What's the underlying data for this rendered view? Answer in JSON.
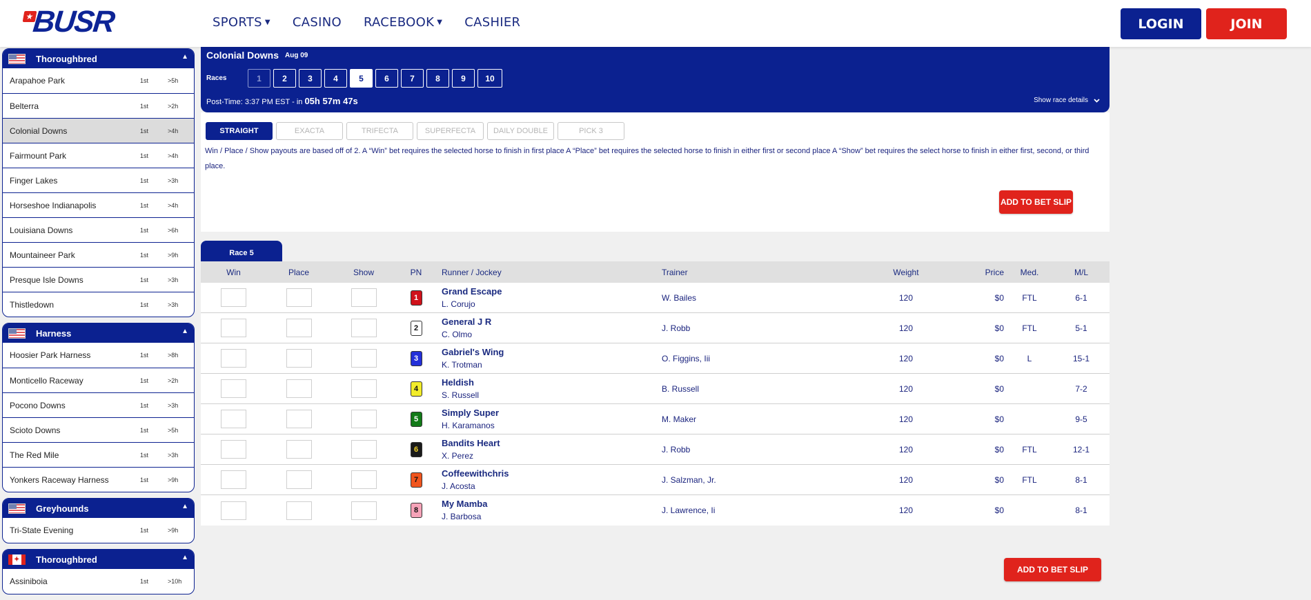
{
  "header": {
    "logo_text": "BUSR",
    "nav": [
      {
        "label": "SPORTS",
        "has_dropdown": true
      },
      {
        "label": "CASINO",
        "has_dropdown": false
      },
      {
        "label": "RACEBOOK",
        "has_dropdown": true
      },
      {
        "label": "CASHIER",
        "has_dropdown": false
      }
    ],
    "login_label": "LOGIN",
    "join_label": "JOIN"
  },
  "sidebar": {
    "groups": [
      {
        "country": "US",
        "title": "Thoroughbred",
        "tracks": [
          {
            "name": "Arapahoe Park",
            "race": "1st",
            "time": ">5h"
          },
          {
            "name": "Belterra",
            "race": "1st",
            "time": ">2h"
          },
          {
            "name": "Colonial Downs",
            "race": "1st",
            "time": ">4h",
            "selected": true
          },
          {
            "name": "Fairmount Park",
            "race": "1st",
            "time": ">4h"
          },
          {
            "name": "Finger Lakes",
            "race": "1st",
            "time": ">3h"
          },
          {
            "name": "Horseshoe Indianapolis",
            "race": "1st",
            "time": ">4h"
          },
          {
            "name": "Louisiana Downs",
            "race": "1st",
            "time": ">6h"
          },
          {
            "name": "Mountaineer Park",
            "race": "1st",
            "time": ">9h"
          },
          {
            "name": "Presque Isle Downs",
            "race": "1st",
            "time": ">3h"
          },
          {
            "name": "Thistledown",
            "race": "1st",
            "time": ">3h"
          }
        ]
      },
      {
        "country": "US",
        "title": "Harness",
        "tracks": [
          {
            "name": "Hoosier Park Harness",
            "race": "1st",
            "time": ">8h"
          },
          {
            "name": "Monticello Raceway",
            "race": "1st",
            "time": ">2h"
          },
          {
            "name": "Pocono Downs",
            "race": "1st",
            "time": ">3h"
          },
          {
            "name": "Scioto Downs",
            "race": "1st",
            "time": ">5h"
          },
          {
            "name": "The Red Mile",
            "race": "1st",
            "time": ">3h"
          },
          {
            "name": "Yonkers Raceway Harness",
            "race": "1st",
            "time": ">9h"
          }
        ]
      },
      {
        "country": "US",
        "title": "Greyhounds",
        "tracks": [
          {
            "name": "Tri-State Evening",
            "race": "1st",
            "time": ">9h"
          }
        ]
      },
      {
        "country": "CA",
        "title": "Thoroughbred",
        "tracks": [
          {
            "name": "Assiniboia",
            "race": "1st",
            "time": ">10h"
          }
        ]
      }
    ]
  },
  "race_header": {
    "track": "Colonial Downs",
    "date": "Aug 09",
    "races_label": "Races",
    "races": [
      "1",
      "2",
      "3",
      "4",
      "5",
      "6",
      "7",
      "8",
      "9",
      "10"
    ],
    "active_race": "5",
    "disabled_races": [
      "1"
    ],
    "post_time_prefix": "Post-Time: 3:37 PM EST - in",
    "countdown": "05h 57m 47s",
    "details_label": "Show race details"
  },
  "bet_types": {
    "tabs": [
      "STRAIGHT",
      "EXACTA",
      "TRIFECTA",
      "SUPERFECTA",
      "DAILY DOUBLE",
      "PICK 3"
    ],
    "active": "STRAIGHT",
    "description": "Win / Place / Show payouts are based off of 2. A “Win” bet requires the selected horse to finish in first place A “Place” bet requires the selected horse to finish in either first or second place A “Show” bet requires the select horse to finish in either first, second, or third place.",
    "add_label": "ADD TO BET SLIP"
  },
  "race_table": {
    "tab_label": "Race 5",
    "columns": {
      "win": "Win",
      "place": "Place",
      "show": "Show",
      "pn": "PN",
      "runner": "Runner / Jockey",
      "trainer": "Trainer",
      "weight": "Weight",
      "price": "Price",
      "med": "Med.",
      "ml": "M/L"
    },
    "runners": [
      {
        "pn": "1",
        "pn_bg": "#d0121b",
        "pn_fg": "#ffffff",
        "name": "Grand Escape",
        "jockey": "L. Corujo",
        "trainer": "W. Bailes",
        "weight": "120",
        "price": "$0",
        "med": "FTL",
        "ml": "6-1"
      },
      {
        "pn": "2",
        "pn_bg": "#ffffff",
        "pn_fg": "#111111",
        "name": "General J R",
        "jockey": "C. Olmo",
        "trainer": "J. Robb",
        "weight": "120",
        "price": "$0",
        "med": "FTL",
        "ml": "5-1"
      },
      {
        "pn": "3",
        "pn_bg": "#2430d8",
        "pn_fg": "#ffffff",
        "name": "Gabriel's Wing",
        "jockey": "K. Trotman",
        "trainer": "O. Figgins, Iii",
        "weight": "120",
        "price": "$0",
        "med": "L",
        "ml": "15-1"
      },
      {
        "pn": "4",
        "pn_bg": "#f2ec2a",
        "pn_fg": "#111111",
        "name": "Heldish",
        "jockey": "S. Russell",
        "trainer": "B. Russell",
        "weight": "120",
        "price": "$0",
        "med": "",
        "ml": "7-2"
      },
      {
        "pn": "5",
        "pn_bg": "#127a18",
        "pn_fg": "#ffffff",
        "name": "Simply Super",
        "jockey": "H. Karamanos",
        "trainer": "M. Maker",
        "weight": "120",
        "price": "$0",
        "med": "",
        "ml": "9-5"
      },
      {
        "pn": "6",
        "pn_bg": "#1a1a1a",
        "pn_fg": "#f2d22a",
        "name": "Bandits Heart",
        "jockey": "X. Perez",
        "trainer": "J. Robb",
        "weight": "120",
        "price": "$0",
        "med": "FTL",
        "ml": "12-1"
      },
      {
        "pn": "7",
        "pn_bg": "#f0551e",
        "pn_fg": "#111111",
        "name": "Coffeewithchris",
        "jockey": "J. Acosta",
        "trainer": "J. Salzman, Jr.",
        "weight": "120",
        "price": "$0",
        "med": "FTL",
        "ml": "8-1"
      },
      {
        "pn": "8",
        "pn_bg": "#f5a3b8",
        "pn_fg": "#111111",
        "name": "My Mamba",
        "jockey": "J. Barbosa",
        "trainer": "J. Lawrence, Ii",
        "weight": "120",
        "price": "$0",
        "med": "",
        "ml": "8-1"
      }
    ]
  },
  "colors": {
    "brand_blue": "#0b2190",
    "brand_red": "#e0231c",
    "page_bg": "#f0f0f0"
  }
}
